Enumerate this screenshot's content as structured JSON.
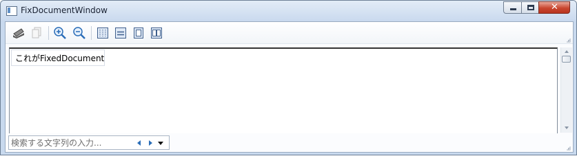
{
  "window": {
    "title": "FixDocumentWindow"
  },
  "caption": {
    "minimize": "minimize-icon",
    "maximize": "maximize-icon",
    "close_glyph": "✕"
  },
  "toolbar": {
    "items": [
      "print-icon",
      "copy-icon",
      "zoom-in-icon",
      "zoom-out-icon",
      "actual-size-icon",
      "page-width-icon",
      "whole-page-icon",
      "two-pages-icon"
    ]
  },
  "document": {
    "text": "これがFixedDocument"
  },
  "find": {
    "placeholder": "検索する文字列の入力..."
  },
  "colors": {
    "accent": "#2a6db8",
    "close": "#c9462f",
    "titlebar": "#c9d9ee"
  }
}
